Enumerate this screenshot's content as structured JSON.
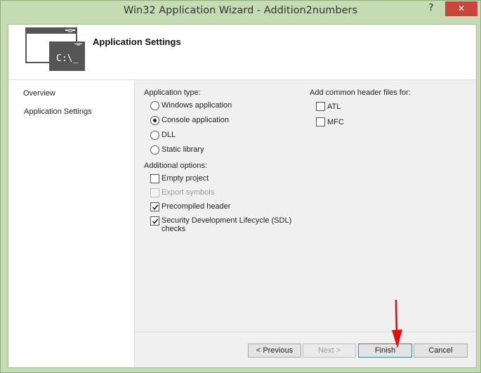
{
  "window": {
    "title": "Win32 Application Wizard - Addition2numbers",
    "help_glyph": "?",
    "close_glyph": "✕"
  },
  "header": {
    "title": "Application Settings",
    "icon": "console-window-icon",
    "icon_text": "C:\\_"
  },
  "nav": {
    "items": [
      {
        "label": "Overview"
      },
      {
        "label": "Application Settings"
      }
    ]
  },
  "app_type": {
    "label": "Application type:",
    "options": [
      {
        "label": "Windows application",
        "checked": false
      },
      {
        "label": "Console application",
        "checked": true
      },
      {
        "label": "DLL",
        "checked": false
      },
      {
        "label": "Static library",
        "checked": false
      }
    ]
  },
  "additional": {
    "label": "Additional options:",
    "options": [
      {
        "label": "Empty project",
        "checked": false,
        "enabled": true
      },
      {
        "label": "Export symbols",
        "checked": false,
        "enabled": false
      },
      {
        "label": "Precompiled header",
        "checked": true,
        "enabled": true
      },
      {
        "label": "Security Development Lifecycle (SDL)",
        "label_line2": "checks",
        "checked": true,
        "enabled": true
      }
    ]
  },
  "headers": {
    "label": "Add common header files for:",
    "options": [
      {
        "label": "ATL",
        "checked": false
      },
      {
        "label": "MFC",
        "checked": false
      }
    ]
  },
  "buttons": {
    "previous": "< Previous",
    "next": "Next >",
    "finish": "Finish",
    "cancel": "Cancel"
  },
  "colors": {
    "close_button": "#c7473c",
    "annotation_arrow": "#e01010",
    "desktop": "#9fc08a"
  }
}
